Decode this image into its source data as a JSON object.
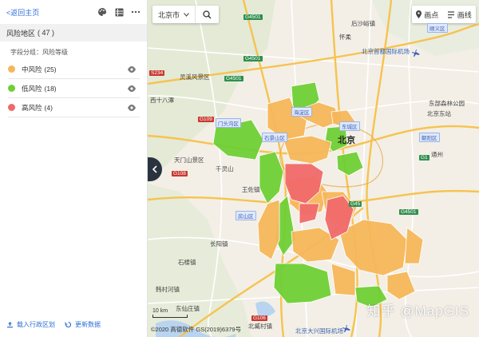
{
  "panel": {
    "back_label": "<返回主页",
    "section_title": "风险地区",
    "section_count": "( 47 )",
    "group_label": "字段分组：风险等级",
    "legend": [
      {
        "label": "中风险",
        "count": "(25)",
        "color": "#f6b65a"
      },
      {
        "label": "低风险",
        "count": "(18)",
        "color": "#6fcf35"
      },
      {
        "label": "高风险",
        "count": "(4)",
        "color": "#f0696a"
      }
    ],
    "import_label": "载入行政区划",
    "refresh_label": "更新数据"
  },
  "map": {
    "city": "北京市",
    "point_tool": "画点",
    "line_tool": "画线",
    "scale_label": "10 km",
    "copyright": "©2020 高德软件 GS(2019)6379号",
    "watermark": "知乎 @MapGIS",
    "labels": {
      "beijing": "北京",
      "lingshan": "灵溪风景区",
      "shibadeng": "西十八潭",
      "tianmen": "天门山景区",
      "qianling": "千灵山",
      "airport": "北京首都国际机场",
      "daxing": "北京大兴国际机场",
      "dongba": "东部森林公园",
      "beijing_zhan": "北京东站",
      "wangzuo": "王佐镇",
      "shixiang": "石楼镇",
      "hanlin": "韩村河镇",
      "yangqiao": "长阳镇",
      "dongping": "东仙庄镇",
      "langzhuang": "北臧村镇",
      "huairou": "怀柔",
      "tongzhou": "通州",
      "houshayu": "后沙峪镇"
    },
    "districts": {
      "mentougou": "门头沟区",
      "shijingshan": "石景山区",
      "haidian": "海淀区",
      "chaoyang": "朝阳区",
      "dongcheng": "东城区",
      "fangshan": "房山区",
      "shunyi": "顺义区"
    },
    "roads": [
      "G4501",
      "G4501",
      "G4501",
      "G109",
      "G108",
      "G1",
      "S234",
      "G4501",
      "G45",
      "G106"
    ]
  }
}
